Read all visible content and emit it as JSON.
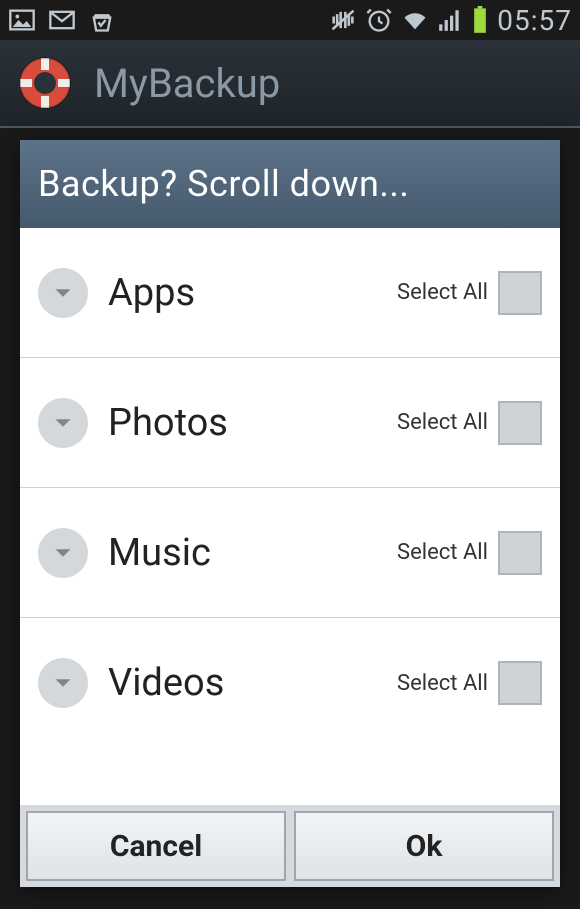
{
  "status_bar": {
    "time": "05:57"
  },
  "app": {
    "title": "MyBackup"
  },
  "dialog": {
    "title": "Backup? Scroll down...",
    "categories": [
      {
        "label": "Apps",
        "select_all_label": "Select All"
      },
      {
        "label": "Photos",
        "select_all_label": "Select All"
      },
      {
        "label": "Music",
        "select_all_label": "Select All"
      },
      {
        "label": "Videos",
        "select_all_label": "Select All"
      }
    ],
    "cancel_label": "Cancel",
    "ok_label": "Ok"
  }
}
